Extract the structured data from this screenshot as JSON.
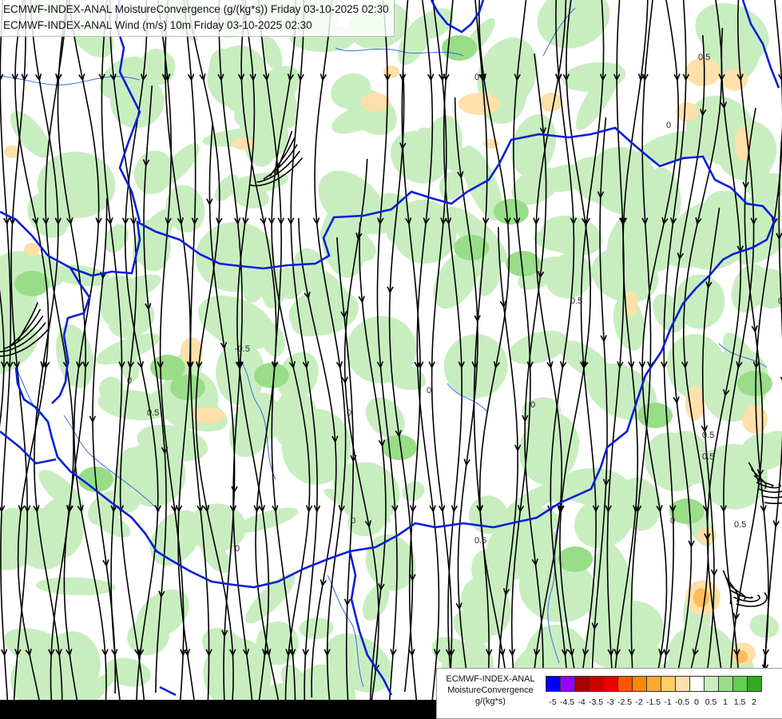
{
  "header": {
    "line1": "ECMWF-INDEX-ANAL MoistureConvergence (g/(kg*s)) Friday 03-10-2025 02:30",
    "line2": "ECMWF-INDEX-ANAL Wind (m/s) 10m Friday 03-10-2025 02:30"
  },
  "legend": {
    "line1": "ECMWF-INDEX-ANAL",
    "line2": "MoistureConvergence",
    "line3": "g/(kg*s)",
    "swatches": [
      "#0000ff",
      "#9900ff",
      "#aa0000",
      "#cc0000",
      "#ee0000",
      "#ff5500",
      "#ff8800",
      "#ffaa33",
      "#ffcc66",
      "#ffe0aa",
      "#ffffff",
      "#c8eec0",
      "#99dd88",
      "#66cc55",
      "#33aa22"
    ],
    "ticks": [
      "-5",
      "-4.5",
      "-4",
      "-3.5",
      "-3",
      "-2.5",
      "-2",
      "-1.5",
      "-1",
      "-0.5",
      "0",
      "0.5",
      "1",
      "1.5",
      "2"
    ]
  },
  "map": {
    "contour_labels": [
      "0.5",
      "0",
      "0",
      "0.5",
      "0",
      "0.5",
      "0",
      "0.5",
      "0",
      "-0.5",
      "0",
      "0.5",
      "0",
      "0.5",
      "0",
      "0",
      "0.5",
      "0"
    ],
    "colors": {
      "border": "#0a1fd6",
      "river": "#3a6be0",
      "streamline": "#000000",
      "conv_light": "#c8eec0",
      "conv_mid": "#99dd88",
      "div_light": "#ffe0aa",
      "div_mid": "#ffbb55"
    }
  }
}
